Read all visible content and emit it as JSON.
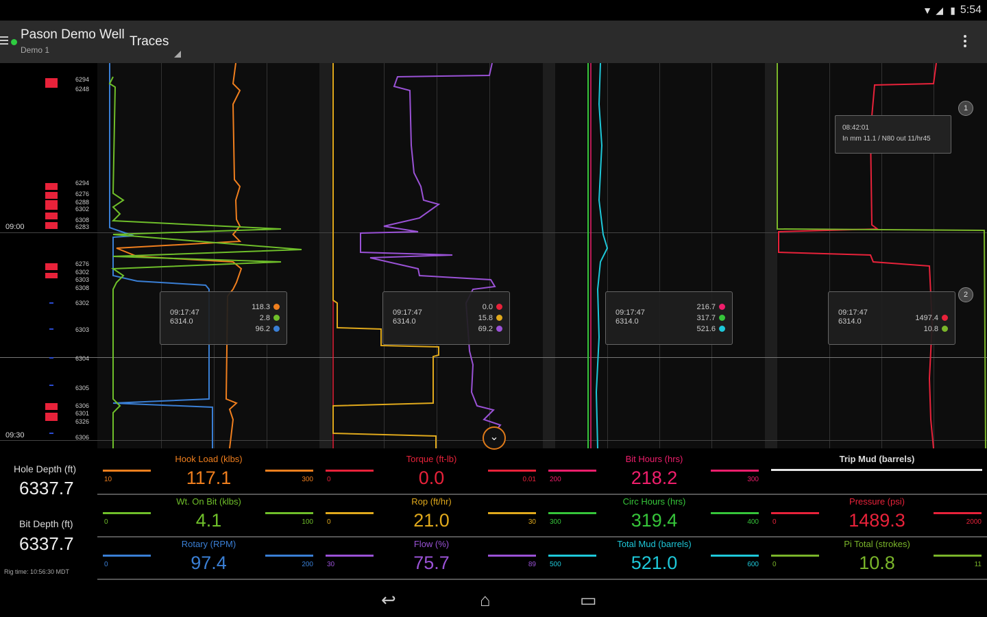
{
  "status_bar": {
    "time": "5:54",
    "icons": [
      "wifi-icon",
      "signal-icon",
      "battery-icon"
    ]
  },
  "action_bar": {
    "title": "Pason Demo Well",
    "subtitle": "Demo 1",
    "spinner_label": "Traces",
    "menu_icon": "overflow-menu-icon"
  },
  "depth_track": {
    "times": [
      "09:00",
      "09:30"
    ],
    "depth_ticks": [
      "6294",
      "6248",
      "6294",
      "6276",
      "6288",
      "6302",
      "6308",
      "6283",
      "6276",
      "6302",
      "6303",
      "6308",
      "6302",
      "6303",
      "6304",
      "6305",
      "6306",
      "6301",
      "6326",
      "6306"
    ]
  },
  "tooltips": [
    {
      "time": "09:17:47",
      "depth": "6314.0",
      "values": [
        {
          "v": "118.3",
          "c": "#f07f1e"
        },
        {
          "v": "2.8",
          "c": "#6fbf2a"
        },
        {
          "v": "96.2",
          "c": "#3a7fd5"
        }
      ]
    },
    {
      "time": "09:17:47",
      "depth": "6314.0",
      "values": [
        {
          "v": "0.0",
          "c": "#e8223a"
        },
        {
          "v": "15.8",
          "c": "#e0a91c"
        },
        {
          "v": "69.2",
          "c": "#9a52d6"
        }
      ]
    },
    {
      "time": "09:17:47",
      "depth": "6314.0",
      "values": [
        {
          "v": "216.7",
          "c": "#f01e6c"
        },
        {
          "v": "317.7",
          "c": "#36c53a"
        },
        {
          "v": "521.6",
          "c": "#1ec8d9"
        }
      ]
    },
    {
      "time": "09:17:47",
      "depth": "6314.0",
      "values": [
        {
          "v": "1497.4",
          "c": "#e8223a"
        },
        {
          "v": "10.8",
          "c": "#7ab52a"
        }
      ]
    }
  ],
  "annotation": {
    "line1": "08:42:01",
    "line2": "In mm 11.1 / N80 out 11/hr45"
  },
  "markers": [
    "1",
    "2"
  ],
  "depth_info": {
    "hole_depth_label": "Hole Depth (ft)",
    "hole_depth": "6337.7",
    "bit_depth_label": "Bit Depth (ft)",
    "bit_depth": "6337.7",
    "rig_time": "Rig time: 10:56:30 MDT"
  },
  "readouts": [
    {
      "label": "Hook Load (klbs)",
      "value": "117.1",
      "min": "10",
      "max": "300",
      "color": "#f07f1e"
    },
    {
      "label": "Torque (ft-lb)",
      "value": "0.0",
      "min": "0",
      "max": "0.01",
      "color": "#e8223a"
    },
    {
      "label": "Bit Hours (hrs)",
      "value": "218.2",
      "min": "200",
      "max": "300",
      "color": "#f01e6c"
    },
    {
      "label": "Trip Mud (barrels)",
      "value": "",
      "min": "",
      "max": "",
      "color": "#e6e6e6"
    },
    {
      "label": "Wt. On Bit (klbs)",
      "value": "4.1",
      "min": "0",
      "max": "100",
      "color": "#6fbf2a"
    },
    {
      "label": "Rop (ft/hr)",
      "value": "21.0",
      "min": "0",
      "max": "30",
      "color": "#e0a91c"
    },
    {
      "label": "Circ Hours (hrs)",
      "value": "319.4",
      "min": "300",
      "max": "400",
      "color": "#36c53a"
    },
    {
      "label": "Pressure (psi)",
      "value": "1489.3",
      "min": "0",
      "max": "2000",
      "color": "#e8223a"
    },
    {
      "label": "Rotary (RPM)",
      "value": "97.4",
      "min": "0",
      "max": "200",
      "color": "#3a7fd5"
    },
    {
      "label": "Flow (%)",
      "value": "75.7",
      "min": "30",
      "max": "89",
      "color": "#9a52d6"
    },
    {
      "label": "Total Mud (barrels)",
      "value": "521.0",
      "min": "500",
      "max": "600",
      "color": "#1ec8d9"
    },
    {
      "label": "Pi Total (strokes)",
      "value": "10.8",
      "min": "0",
      "max": "11",
      "color": "#7ab52a"
    }
  ],
  "nav": {
    "back": "back-icon",
    "home": "home-icon",
    "recents": "recents-icon"
  }
}
